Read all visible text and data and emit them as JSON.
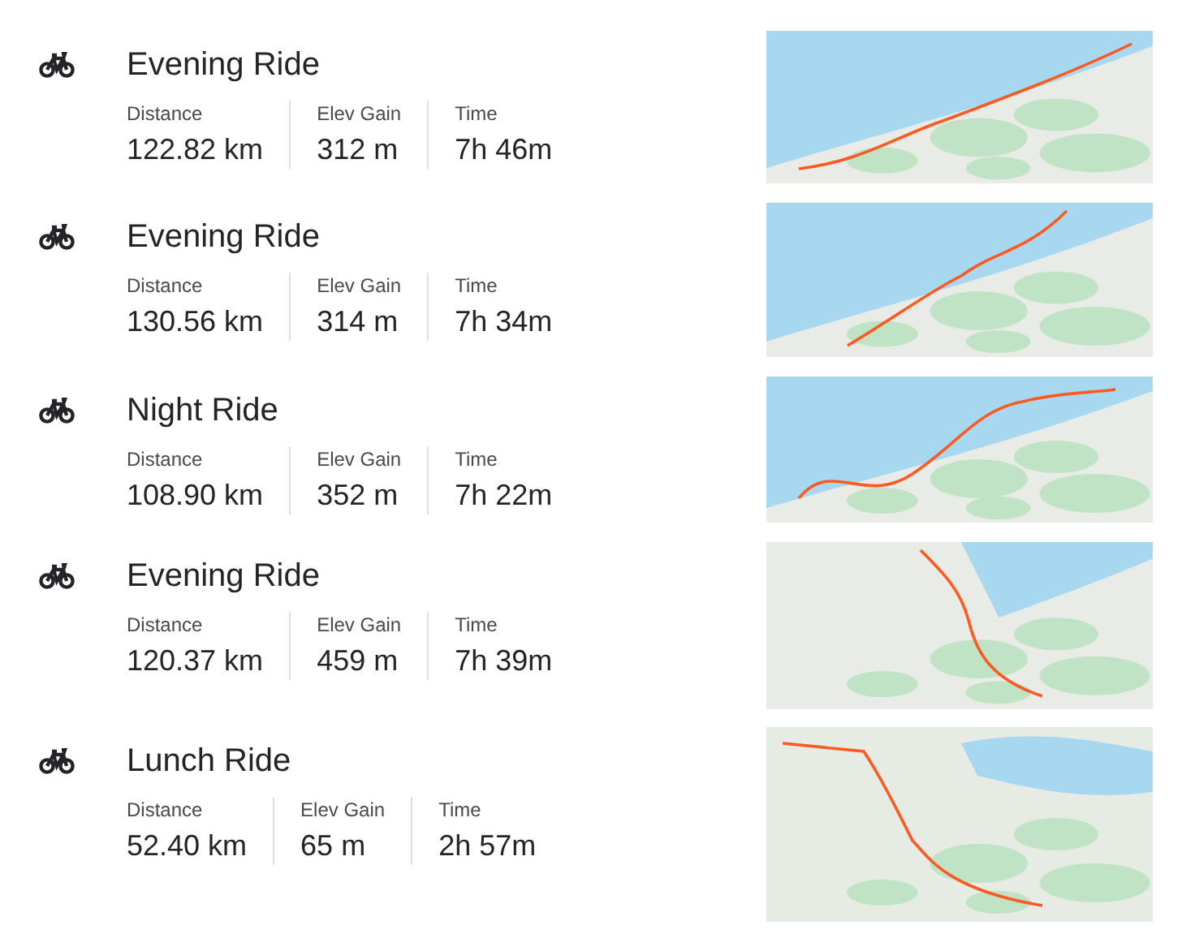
{
  "activities": [
    {
      "kind": "ride",
      "title": "Evening Ride",
      "stats": [
        {
          "label": "Distance",
          "value": "122.82 km"
        },
        {
          "label": "Elev Gain",
          "value": "312 m"
        },
        {
          "label": "Time",
          "value": "7h 46m"
        }
      ]
    },
    {
      "kind": "ride",
      "title": "Evening Ride",
      "stats": [
        {
          "label": "Distance",
          "value": "130.56 km"
        },
        {
          "label": "Elev Gain",
          "value": "314 m"
        },
        {
          "label": "Time",
          "value": "7h 34m"
        }
      ]
    },
    {
      "kind": "ride",
      "title": "Night Ride",
      "stats": [
        {
          "label": "Distance",
          "value": "108.90 km"
        },
        {
          "label": "Elev Gain",
          "value": "352 m"
        },
        {
          "label": "Time",
          "value": "7h 22m"
        }
      ]
    },
    {
      "kind": "ride",
      "title": "Evening Ride",
      "stats": [
        {
          "label": "Distance",
          "value": "120.37 km"
        },
        {
          "label": "Elev Gain",
          "value": "459 m"
        },
        {
          "label": "Time",
          "value": "7h 39m"
        }
      ]
    },
    {
      "kind": "ride",
      "title": "Lunch Ride",
      "stats": [
        {
          "label": "Distance",
          "value": "52.40 km"
        },
        {
          "label": "Elev Gain",
          "value": "65 m"
        },
        {
          "label": "Time",
          "value": "2h 57m"
        }
      ]
    }
  ]
}
